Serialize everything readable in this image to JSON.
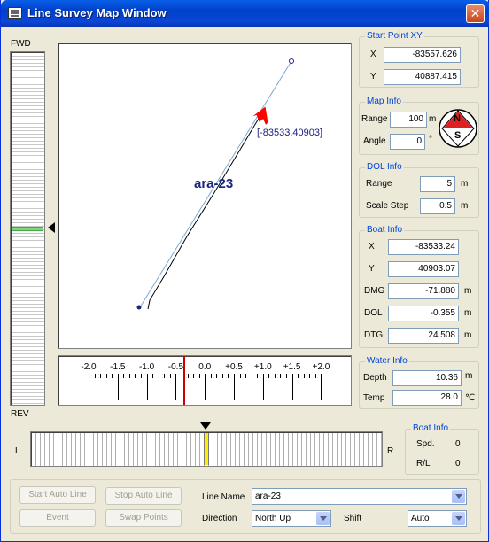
{
  "window": {
    "title": "Line Survey Map Window",
    "close_label": "✕"
  },
  "vertical_gauge": {
    "top_label": "FWD",
    "bottom_label": "REV",
    "level": 0.5
  },
  "map": {
    "line_name": "ara-23",
    "boat_coord_label": "[-83533,40903]",
    "start_x": -83557.626,
    "start_y": 40887.415,
    "boat_x": -83533.24,
    "boat_y": 40903.07
  },
  "scale": {
    "ticks": [
      "-2.0",
      "-1.5",
      "-1.0",
      "-0.5",
      "0.0",
      "+0.5",
      "+1.0",
      "+1.5",
      "+2.0"
    ],
    "marker_value": -0.355
  },
  "start_point": {
    "title": "Start Point XY",
    "x_label": "X",
    "x_value": "-83557.626",
    "y_label": "Y",
    "y_value": "40887.415"
  },
  "map_info": {
    "title": "Map Info",
    "range_label": "Range",
    "range_value": "100",
    "range_unit": "m",
    "angle_label": "Angle",
    "angle_value": "0",
    "angle_unit": "°",
    "compass_n": "N",
    "compass_s": "S"
  },
  "dol_info": {
    "title": "DOL Info",
    "range_label": "Range",
    "range_value": "5",
    "range_unit": "m",
    "scale_label": "Scale Step",
    "scale_value": "0.5",
    "scale_unit": "m"
  },
  "boat_info": {
    "title": "Boat Info",
    "x_label": "X",
    "x_value": "-83533.24",
    "y_label": "Y",
    "y_value": "40903.07",
    "dmg_label": "DMG",
    "dmg_value": "-71.880",
    "dmg_unit": "m",
    "dol_label": "DOL",
    "dol_value": "-0.355",
    "dol_unit": "m",
    "dtg_label": "DTG",
    "dtg_value": "24.508",
    "dtg_unit": "m"
  },
  "water_info": {
    "title": "Water Info",
    "depth_label": "Depth",
    "depth_value": "10.36",
    "depth_unit": "m",
    "temp_label": "Temp",
    "temp_value": "28.0",
    "temp_unit": "℃"
  },
  "rudder": {
    "left_label": "L",
    "right_label": "R",
    "level": 0.5
  },
  "boat_info2": {
    "title": "Boat Info",
    "spd_label": "Spd.",
    "spd_value": "0",
    "rl_label": "R/L",
    "rl_value": "0"
  },
  "controls": {
    "start_auto_line": "Start Auto Line",
    "stop_auto_line": "Stop Auto Line",
    "event": "Event",
    "swap_points": "Swap Points",
    "line_name_label": "Line Name",
    "line_name_value": "ara-23",
    "direction_label": "Direction",
    "direction_value": "North Up",
    "shift_label": "Shift",
    "shift_value": "Auto"
  },
  "colors": {
    "accent": "#0046d5",
    "boat_arrow": "#ff0000",
    "gauge_marker": "#7fd67f",
    "rudder_marker": "#ffee00",
    "scale_marker": "#cc0000"
  }
}
